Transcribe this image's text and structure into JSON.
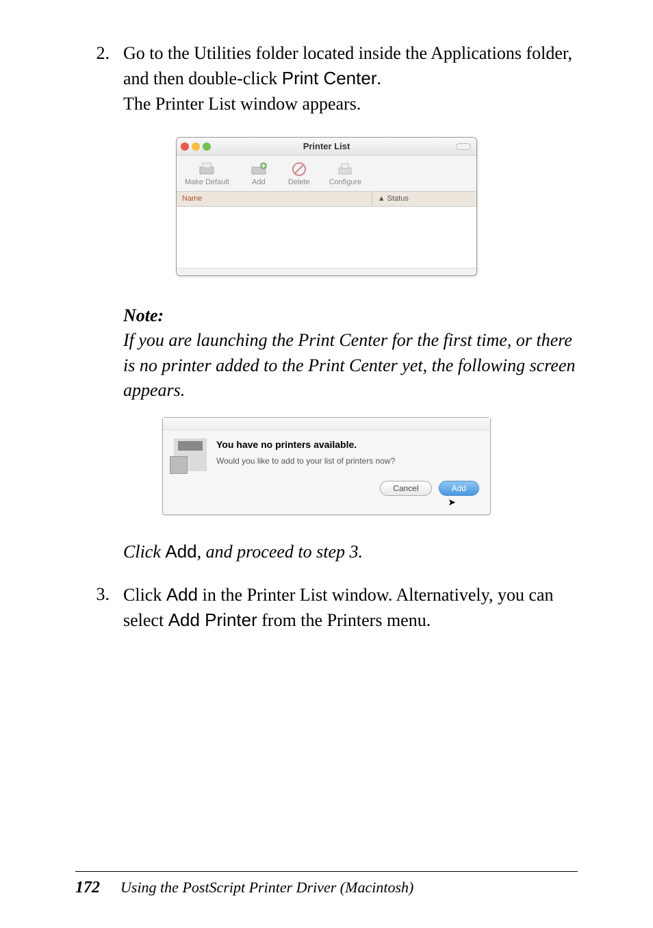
{
  "step2": {
    "num": "2.",
    "line1_a": "Go to the Utilities folder located inside the Applications folder, and then double-click ",
    "line1_b": "Print Center",
    "line1_c": ".",
    "line2": "The Printer List window appears."
  },
  "printer_window": {
    "title": "Printer List",
    "toolbar": {
      "make_default": "Make Default",
      "add": "Add",
      "delete": "Delete",
      "configure": "Configure"
    },
    "headers": {
      "name": "Name",
      "status": "Status"
    }
  },
  "note": {
    "heading": "Note:",
    "body": "If you are launching the Print Center for the first time, or there is no printer added to the Print Center yet, the following screen appears."
  },
  "dialog": {
    "heading": "You have no printers available.",
    "body": "Would you like to add to your list of printers now?",
    "cancel": "Cancel",
    "add": "Add"
  },
  "click_add": {
    "a": "Click ",
    "b": "Add",
    "c": ", and proceed to step 3."
  },
  "step3": {
    "num": "3.",
    "a": "Click ",
    "b": "Add",
    "c": " in the Printer List window. Alternatively, you can select ",
    "d": "Add Printer",
    "e": " from the Printers menu."
  },
  "footer": {
    "page": "172",
    "chapter": "Using the PostScript Printer Driver (Macintosh)"
  }
}
